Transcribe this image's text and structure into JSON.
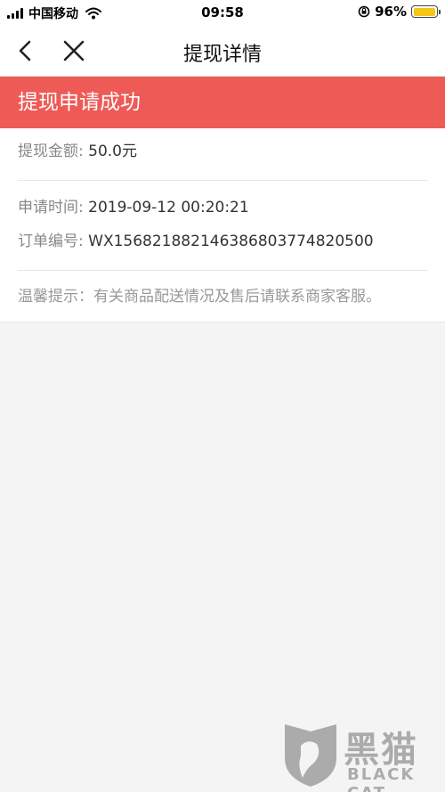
{
  "status_bar": {
    "carrier": "中国移动",
    "time": "09:58",
    "battery": "96%",
    "battery_level": 0.96,
    "icons": [
      "signal-icon",
      "wifi-icon",
      "rotation-lock-icon",
      "battery-icon"
    ]
  },
  "nav": {
    "title": "提现详情",
    "back_icon": "chevron-left-icon",
    "close_icon": "close-icon"
  },
  "banner": {
    "text": "提现申请成功",
    "color": "#ee5a56"
  },
  "amount": {
    "label": "提现金额:",
    "value": "50.0元"
  },
  "details": {
    "time_label": "申请时间:",
    "time_value": "2019-09-12 00:20:21",
    "order_label": "订单编号:",
    "order_value": "WX156821882146386803774820500"
  },
  "hint": {
    "text": "温馨提示：有关商品配送情况及售后请联系商家客服。"
  },
  "watermark": {
    "text": "黑猫",
    "sub": "BLACK CAT"
  }
}
